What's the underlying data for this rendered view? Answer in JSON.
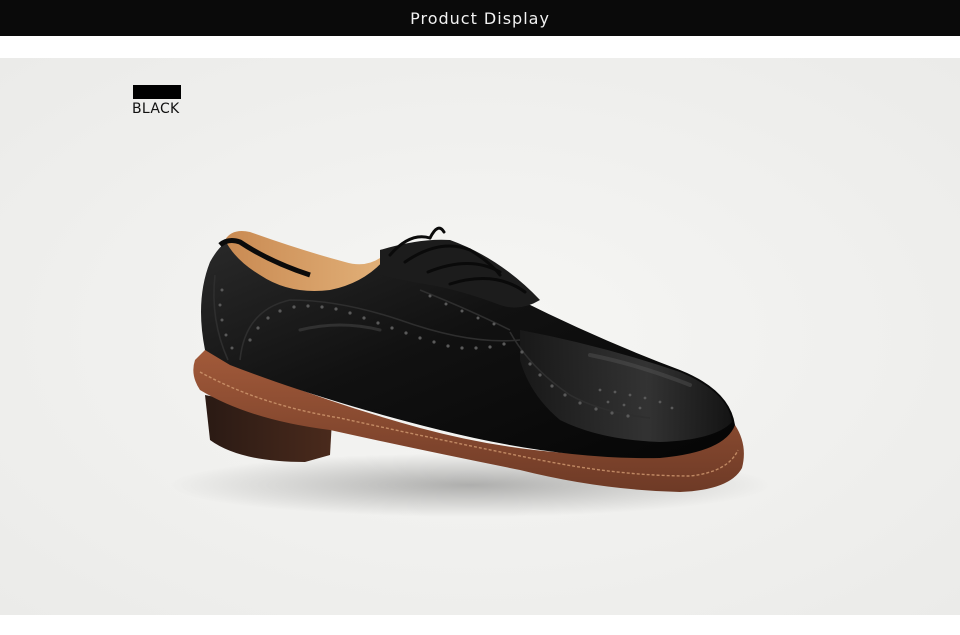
{
  "header": {
    "title": "Product Display"
  },
  "swatch": {
    "label": "BLACK",
    "color": "#000000"
  },
  "product": {
    "image_icon": "oxford-brogue-shoe-icon"
  },
  "colors": {
    "header_bg": "#0a0a0a",
    "photo_bg": "#f0f0ee",
    "leather": "#141414",
    "sole": "#8a4a30",
    "insole": "#d9a36a"
  }
}
